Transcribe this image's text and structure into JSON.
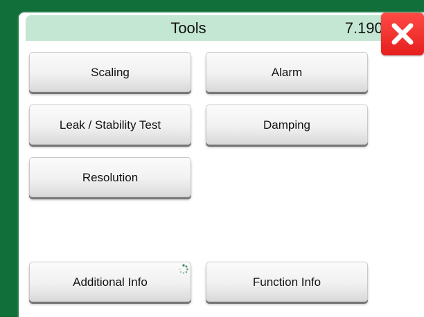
{
  "header": {
    "title": "Tools",
    "value": "7.1901"
  },
  "close_button": {
    "icon": "close-icon",
    "color": "#e92220"
  },
  "buttons": {
    "scaling": "Scaling",
    "alarm": "Alarm",
    "leak_stability_test": "Leak / Stability Test",
    "damping": "Damping",
    "resolution": "Resolution",
    "additional_info": "Additional Info",
    "function_info": "Function Info"
  },
  "colors": {
    "frame": "#11703a",
    "titlebar": "#c3e7d3",
    "panel": "#ffffff"
  }
}
